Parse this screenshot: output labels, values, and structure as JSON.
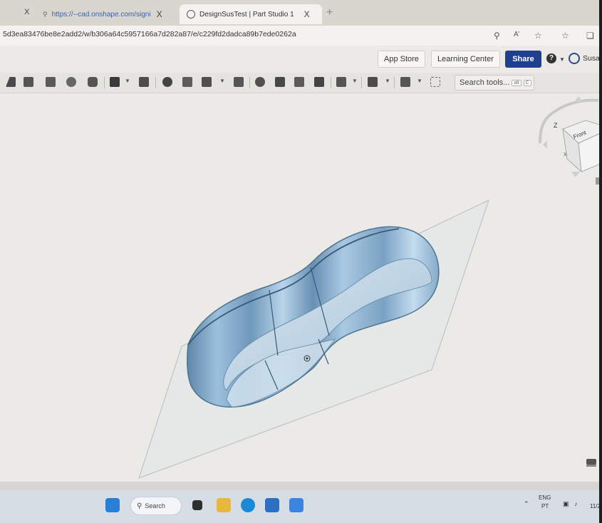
{
  "browser": {
    "tabs": [
      {
        "label": "https://--cad.onshape.com/signi",
        "active": false
      },
      {
        "label": "DesignSusTest | Part Studio 1",
        "active": true
      }
    ],
    "tab_close": "X",
    "new_tab": "+",
    "address": "5d3ea83476be8e2add2/w/b306a64c5957166a7d282a87/e/c229fd2dadca89b7ede0262a",
    "icons": [
      "key-icon",
      "read-aloud-icon",
      "favorites-add-icon",
      "favorites-icon",
      "collections-icon"
    ]
  },
  "header": {
    "app_store": "App Store",
    "learning_center": "Learning Center",
    "share": "Share",
    "help": "?",
    "username": "Susa"
  },
  "toolbar": {
    "search_tools": "Search tools...",
    "shortcut_key": "alt",
    "shortcut_letter": "C"
  },
  "viewcube": {
    "face_label": "Front",
    "axis_z": "Z",
    "axis_x": "X"
  },
  "taskbar": {
    "search": "Search",
    "lang": "ENG",
    "region": "PT",
    "date": "11/2"
  },
  "colors": {
    "share": "#1f3f8f",
    "part_blue": "#7da6c7",
    "part_edge": "#4d7391",
    "viewport": "#ebeae6"
  }
}
